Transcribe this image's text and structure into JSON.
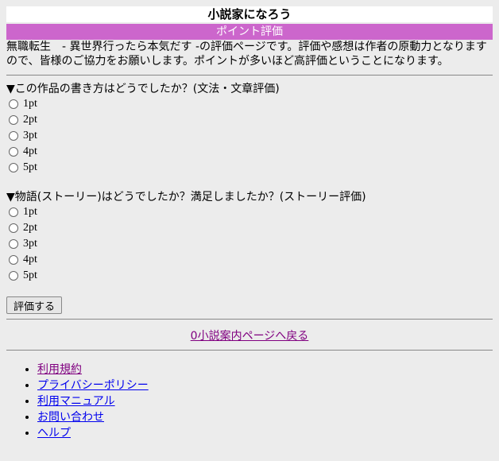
{
  "header": {
    "site_title": "小説家になろう",
    "page_label": "ポイント評価"
  },
  "intro": "無職転生　- 異世界行ったら本気だす -の評価ページです。評価や感想は作者の原動力となりますので、皆様のご協力をお願いします。ポイントが多いほど高評価ということになります。",
  "questions": [
    {
      "title": "▼この作品の書き方はどうでしたか？(文法・文章評価)",
      "options": [
        "1pt",
        "2pt",
        "3pt",
        "4pt",
        "5pt"
      ]
    },
    {
      "title": "▼物語(ストーリー)はどうでしたか？満足しましたか？(ストーリー評価)",
      "options": [
        "1pt",
        "2pt",
        "3pt",
        "4pt",
        "5pt"
      ]
    }
  ],
  "submit_label": "評価する",
  "back_link": "0小説案内ページへ戻る",
  "footer_links": [
    "利用規約",
    "プライバシーポリシー",
    "利用マニュアル",
    "お問い合わせ",
    "ヘルプ"
  ],
  "colors": {
    "page_bar": "#cc66cc",
    "visited_link": "#800080",
    "link": "#0000ee"
  }
}
